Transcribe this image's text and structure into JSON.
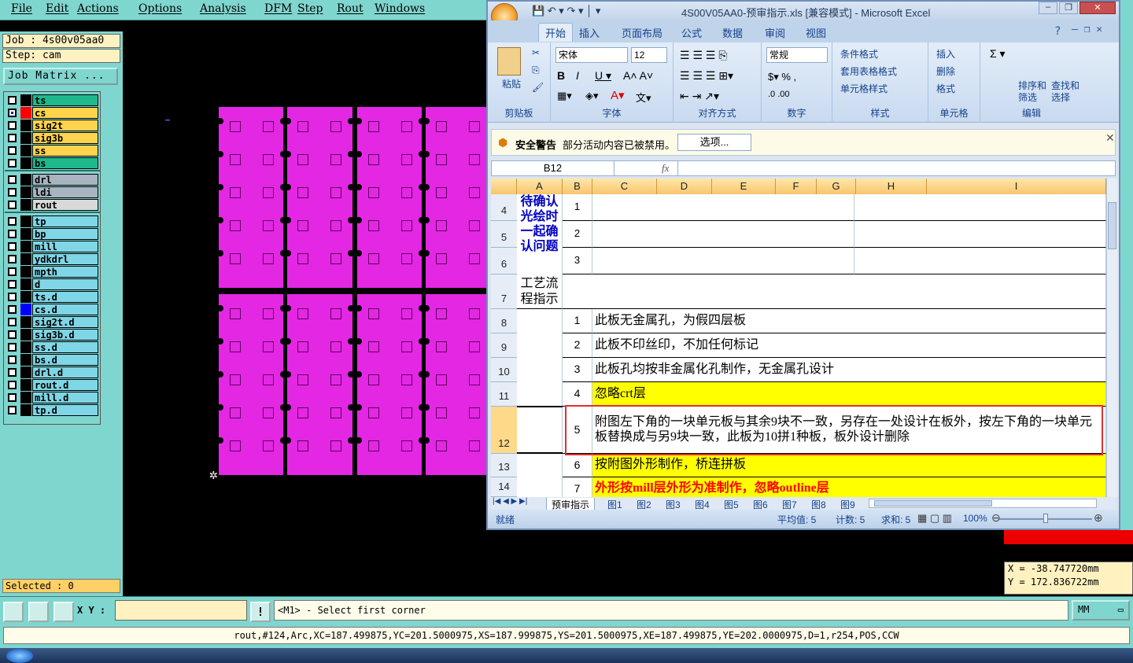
{
  "menu": [
    "File",
    "Edit",
    "Actions",
    "Options",
    "Analysis",
    "DFM",
    "Step",
    "Rout",
    "Windows"
  ],
  "job": {
    "job_label": "Job : 4s00v05aa0",
    "step_label": "Step: cam",
    "matrix_button": "Job Matrix ...",
    "selected": "Selected : 0"
  },
  "layers": [
    {
      "name": "ts",
      "color": "#1fb88a",
      "swatch": "#000000",
      "checked": false
    },
    {
      "name": "cs",
      "color": "#ffd34d",
      "swatch": "#ff0000",
      "checked": true
    },
    {
      "name": "sig2t",
      "color": "#ffd34d",
      "swatch": "#000000",
      "checked": false
    },
    {
      "name": "sig3b",
      "color": "#ffd34d",
      "swatch": "#000000",
      "checked": false
    },
    {
      "name": "ss",
      "color": "#ffd34d",
      "swatch": "#000000",
      "checked": false
    },
    {
      "name": "bs",
      "color": "#1fb88a",
      "swatch": "#000000",
      "checked": false
    },
    {
      "name": "drl",
      "color": "#a8b4c0",
      "swatch": "#000000",
      "checked": false
    },
    {
      "name": "ldi",
      "color": "#a8b4c0",
      "swatch": "#000000",
      "checked": false
    },
    {
      "name": "rout",
      "color": "#d9d9d9",
      "swatch": "#000000",
      "checked": false
    },
    {
      "name": "tp",
      "color": "#7fd6e6",
      "swatch": "#000000",
      "checked": false
    },
    {
      "name": "bp",
      "color": "#7fd6e6",
      "swatch": "#000000",
      "checked": false
    },
    {
      "name": "mill",
      "color": "#7fd6e6",
      "swatch": "#000000",
      "checked": false
    },
    {
      "name": "ydkdrl",
      "color": "#7fd6e6",
      "swatch": "#000000",
      "checked": false
    },
    {
      "name": "mpth",
      "color": "#7fd6e6",
      "swatch": "#000000",
      "checked": false
    },
    {
      "name": "d",
      "color": "#7fd6e6",
      "swatch": "#000000",
      "checked": false
    },
    {
      "name": "ts.d",
      "color": "#7fd6e6",
      "swatch": "#000000",
      "checked": false
    },
    {
      "name": "cs.d",
      "color": "#7fd6e6",
      "swatch": "#0000ff",
      "checked": false
    },
    {
      "name": "sig2t.d",
      "color": "#7fd6e6",
      "swatch": "#000000",
      "checked": false
    },
    {
      "name": "sig3b.d",
      "color": "#7fd6e6",
      "swatch": "#000000",
      "checked": false
    },
    {
      "name": "ss.d",
      "color": "#7fd6e6",
      "swatch": "#000000",
      "checked": false
    },
    {
      "name": "bs.d",
      "color": "#7fd6e6",
      "swatch": "#000000",
      "checked": false
    },
    {
      "name": "drl.d",
      "color": "#7fd6e6",
      "swatch": "#000000",
      "checked": false
    },
    {
      "name": "rout.d",
      "color": "#7fd6e6",
      "swatch": "#000000",
      "checked": false
    },
    {
      "name": "mill.d",
      "color": "#7fd6e6",
      "swatch": "#000000",
      "checked": false
    },
    {
      "name": "tp.d",
      "color": "#7fd6e6",
      "swatch": "#000000",
      "checked": false
    }
  ],
  "excel": {
    "title": "4S00V05AA0-预审指示.xls  [兼容模式] - Microsoft Excel",
    "tabs": [
      "开始",
      "插入",
      "页面布局",
      "公式",
      "数据",
      "审阅",
      "视图"
    ],
    "groups": [
      "剪贴板",
      "字体",
      "对齐方式",
      "数字",
      "样式",
      "单元格",
      "编辑"
    ],
    "paste": "粘贴",
    "font": "宋体",
    "size": "12",
    "number_format": "常规",
    "styles": [
      "条件格式",
      "套用表格格式",
      "单元格样式"
    ],
    "cells_btns": [
      "插入",
      "删除",
      "格式"
    ],
    "edit_btns": [
      "排序和\n筛选",
      "查找和\n选择"
    ],
    "security_label": "安全警告",
    "security_text": "部分活动内容已被禁用。",
    "security_button": "选项...",
    "namebox": "B12",
    "fx": "fx",
    "columns": [
      "A",
      "B",
      "C",
      "D",
      "E",
      "F",
      "G",
      "H",
      "I"
    ],
    "row_numbers": [
      "4",
      "5",
      "6",
      "7",
      "8",
      "9",
      "10",
      "11",
      "12",
      "13",
      "14"
    ],
    "confirm_header": "待确认光绘时一起确认问题",
    "process_header": "工艺流程指示",
    "confirm_nums": [
      "1",
      "2",
      "3"
    ],
    "items": [
      {
        "num": "1",
        "text": "此板无金属孔，为假四层板",
        "bg": "#ffffff",
        "color": "#000000"
      },
      {
        "num": "2",
        "text": "此板不印丝印，不加任何标记",
        "bg": "#ffffff",
        "color": "#000000"
      },
      {
        "num": "3",
        "text": "此板孔均按非金属化孔制作，无金属孔设计",
        "bg": "#ffffff",
        "color": "#000000"
      },
      {
        "num": "4",
        "text": "忽略crt层",
        "bg": "#ffff00",
        "color": "#000000"
      },
      {
        "num": "5",
        "text": "附图左下角的一块单元板与其余9块不一致，另存在一处设计在板外，按左下角的一块单元板替换成与另9块一致，此板为10拼1种板，板外设计删除",
        "bg": "#ffffff",
        "color": "#000000"
      },
      {
        "num": "6",
        "text": "按附图外形制作，桥连拼板",
        "bg": "#ffff00",
        "color": "#000000"
      },
      {
        "num": "7",
        "text": "外形按mill层外形为准制作，忽略outline层",
        "bg": "#ffff00",
        "color": "#ff0000"
      }
    ],
    "sheets": [
      "预审指示",
      "图1",
      "图2",
      "图3",
      "图4",
      "图5",
      "图6",
      "图7",
      "图8",
      "图9"
    ],
    "status_ready": "就绪",
    "avg": "平均值: 5",
    "count": "计数: 5",
    "sum": "求和: 5",
    "zoom": "100%"
  },
  "coords": {
    "x": "X = -38.747720mm",
    "y": "Y = 172.836722mm"
  },
  "toolbar": {
    "xy_label": "X Y :",
    "xy_value": "",
    "prompt": "<M1> - Select first corner",
    "units": "MM"
  },
  "cmdline": "rout,#124,Arc,XC=187.499875,YC=201.5000975,XS=187.999875,YS=201.5000975,XE=187.499875,YE=202.0000975,D=1,r254,POS,CCW",
  "colors": {
    "accent": "#7fd6cf",
    "panel_fill": "#e327e3",
    "highlight": "#ffff00",
    "selection": "#e03030"
  }
}
